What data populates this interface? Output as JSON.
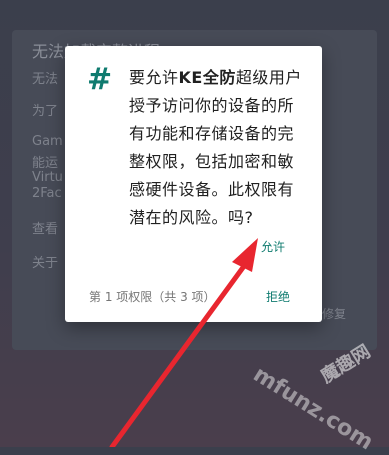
{
  "background_dialog": {
    "title": "无法加载完整进程",
    "lines": [
      "无法",
      "为了",
      "Gam",
      "能运",
      "Virtu",
      "2Fac",
      "查看",
      "关于"
    ],
    "repair_label": "修复"
  },
  "permission_dialog": {
    "icon": "hash-icon",
    "message_prefix": "要允许",
    "app_name": "KE全防",
    "message_suffix": "超级用户授予访问你的设备的所有功能和存储设备的完整权限，包括加密和敏感硬件设备。此权限有潜在的风险。吗?",
    "allow_label": "允许",
    "counter": "第 1 项权限（共 3 项）",
    "deny_label": "拒绝"
  },
  "watermark": {
    "text_cn": "魔趣网",
    "text_en": "mfunz.com"
  },
  "colors": {
    "accent": "#0f7b6f",
    "arrow": "#e8262f",
    "dialog_bg": "#ffffff",
    "screen_bg": "#3d404c"
  }
}
